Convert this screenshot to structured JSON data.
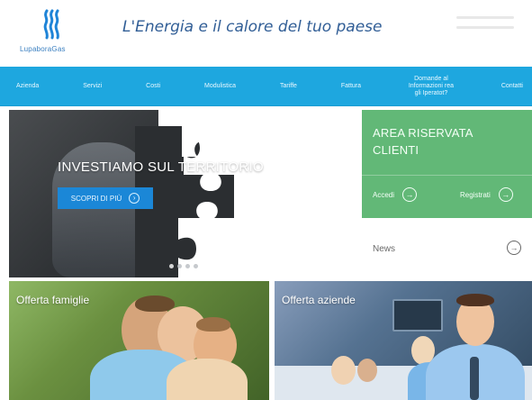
{
  "header": {
    "brand": "LupaboraGas",
    "tagline": "L'Energia e il calore del tuo paese"
  },
  "nav": {
    "items": [
      {
        "label": "Azienda"
      },
      {
        "label": "Servizi"
      },
      {
        "label": "Costi"
      },
      {
        "label": "Modulistica"
      },
      {
        "label": "Tariffe"
      },
      {
        "label": "Fattura"
      },
      {
        "label": "Domande al Informazioni rea gli Iperatot?"
      },
      {
        "label": "Contatti"
      }
    ]
  },
  "hero": {
    "title": "INVESTIAMO SUL TERRITORIO",
    "button_label": "SCOPRI DI PIÙ",
    "button_icon": "chevron-right-icon"
  },
  "reserved_area": {
    "title": "AREA RISERVATA\nCLIENTI",
    "actions": [
      {
        "label": "Accedi",
        "icon": "arrow-right-circle-icon"
      },
      {
        "label": "Registrati",
        "icon": "arrow-right-circle-icon"
      }
    ]
  },
  "news": {
    "label": "News",
    "icon": "arrow-right-circle-icon"
  },
  "offers": {
    "family": {
      "label": "Offerta famiglie"
    },
    "business": {
      "label": "Offerta aziende"
    }
  },
  "theme": {
    "nav_blue": "#1ea7df",
    "accent_green": "#62b877",
    "text_blue": "#315e96"
  }
}
